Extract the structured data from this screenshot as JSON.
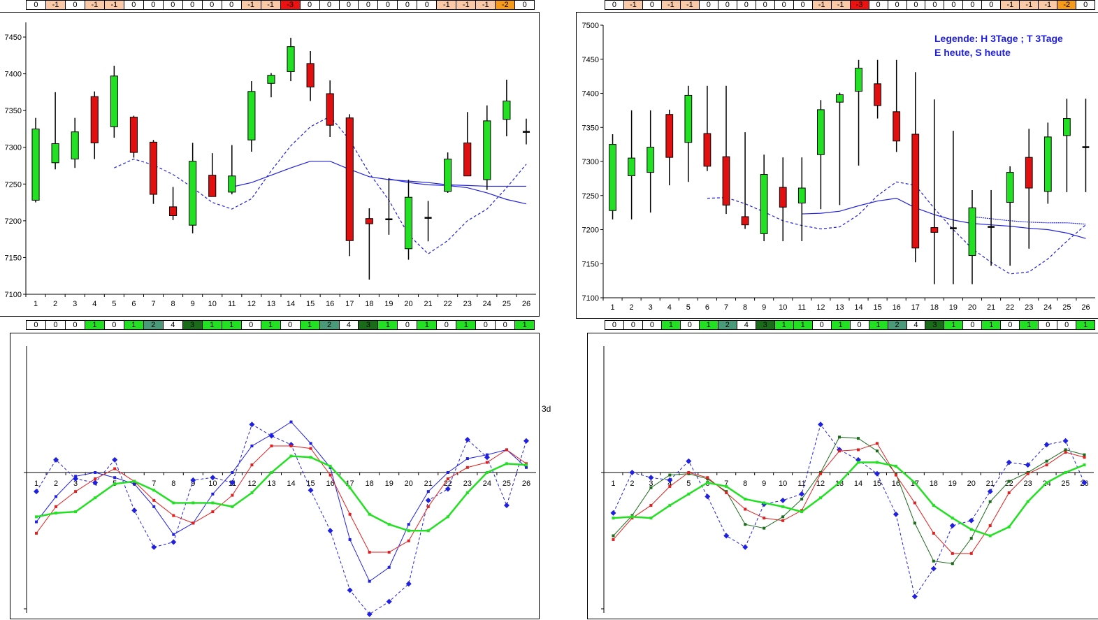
{
  "strips": {
    "top_left": [
      "0",
      "-1",
      "0",
      "-1",
      "-1",
      "0",
      "0",
      "0",
      "0",
      "0",
      "0",
      "-1",
      "-1",
      "-3",
      "0",
      "0",
      "0",
      "0",
      "0",
      "0",
      "0",
      "-1",
      "-1",
      "-1",
      "-2",
      "0"
    ],
    "top_right": [
      "0",
      "-1",
      "0",
      "-1",
      "-1",
      "0",
      "0",
      "0",
      "0",
      "0",
      "0",
      "-1",
      "-1",
      "-3",
      "0",
      "0",
      "0",
      "0",
      "0",
      "0",
      "0",
      "-1",
      "-1",
      "-1",
      "-2",
      "0"
    ],
    "bottom_left": [
      "0",
      "0",
      "0",
      "1",
      "0",
      "1",
      "2",
      "4",
      "3",
      "1",
      "1",
      "0",
      "1",
      "0",
      "1",
      "2",
      "4",
      "3",
      "1",
      "0",
      "1",
      "0",
      "1",
      "0",
      "0",
      "1"
    ],
    "bottom_right": [
      "0",
      "0",
      "0",
      "1",
      "0",
      "1",
      "2",
      "4",
      "3",
      "1",
      "1",
      "0",
      "1",
      "0",
      "1",
      "2",
      "4",
      "3",
      "1",
      "0",
      "1",
      "0",
      "1",
      "0",
      "0",
      "1"
    ]
  },
  "colors": {
    "up_candle": "#22e022",
    "down_candle": "#e01010",
    "ma_blue": "#2020e0",
    "line_red": "#e02020",
    "line_green": "#22e022",
    "line_darkgreen": "#1a6b1a",
    "neg1": "#f9c9a8",
    "neg2": "#f59a1a",
    "neg3": "#ee1111",
    "pos1": "#22e022",
    "pos2": "#4a9a7a",
    "pos3": "#1a6b1a",
    "pos4": "#ffffff"
  },
  "legend": {
    "line1": "Legende: H 3Tage ; T 3Tage",
    "line2": "E heute, S heute"
  },
  "side_label": "3d",
  "chart_data": [
    {
      "type": "candlestick",
      "categories": [
        "1",
        "2",
        "3",
        "4",
        "5",
        "6",
        "7",
        "8",
        "9",
        "10",
        "11",
        "12",
        "13",
        "14",
        "15",
        "16",
        "17",
        "18",
        "19",
        "20",
        "21",
        "22",
        "23",
        "24",
        "25",
        "26"
      ],
      "yticks": [
        7100,
        7150,
        7200,
        7250,
        7300,
        7350,
        7400,
        7450
      ],
      "ylim": [
        7100,
        7470
      ],
      "candles": [
        {
          "o": 7228,
          "c": 7325,
          "h": 7340,
          "l": 7225
        },
        {
          "o": 7279,
          "c": 7305,
          "h": 7375,
          "l": 7270
        },
        {
          "o": 7284,
          "c": 7321,
          "h": 7340,
          "l": 7272
        },
        {
          "o": 7369,
          "c": 7306,
          "h": 7376,
          "l": 7284
        },
        {
          "o": 7328,
          "c": 7397,
          "h": 7411,
          "l": 7313
        },
        {
          "o": 7341,
          "c": 7293,
          "h": 7343,
          "l": 7286
        },
        {
          "o": 7307,
          "c": 7236,
          "h": 7310,
          "l": 7223
        },
        {
          "o": 7219,
          "c": 7207,
          "h": 7246,
          "l": 7201
        },
        {
          "o": 7194,
          "c": 7281,
          "h": 7306,
          "l": 7183
        },
        {
          "o": 7262,
          "c": 7233,
          "h": 7292,
          "l": 7233
        },
        {
          "o": 7239,
          "c": 7261,
          "h": 7303,
          "l": 7236
        },
        {
          "o": 7310,
          "c": 7376,
          "h": 7390,
          "l": 7294
        },
        {
          "o": 7387,
          "c": 7398,
          "h": 7401,
          "l": 7368
        },
        {
          "o": 7403,
          "c": 7437,
          "h": 7449,
          "l": 7390
        },
        {
          "o": 7414,
          "c": 7382,
          "h": 7431,
          "l": 7363
        },
        {
          "o": 7373,
          "c": 7330,
          "h": 7391,
          "l": 7314
        },
        {
          "o": 7340,
          "c": 7173,
          "h": 7345,
          "l": 7152
        },
        {
          "o": 7203,
          "c": 7196,
          "h": 7217,
          "l": 7120
        },
        {
          "o": 7202,
          "c": 7202,
          "h": 7258,
          "l": 7181
        },
        {
          "o": 7162,
          "c": 7232,
          "h": 7256,
          "l": 7147
        },
        {
          "o": 7204,
          "c": 7204,
          "h": 7227,
          "l": 7172
        },
        {
          "o": 7240,
          "c": 7284,
          "h": 7293,
          "l": 7238
        },
        {
          "o": 7306,
          "c": 7261,
          "h": 7348,
          "l": 7262
        },
        {
          "o": 7256,
          "c": 7336,
          "h": 7357,
          "l": 7242
        },
        {
          "o": 7338,
          "c": 7363,
          "h": 7392,
          "l": 7315
        },
        {
          "o": 7321,
          "c": 7321,
          "h": 7339,
          "l": 7304
        }
      ],
      "series": [
        {
          "style": "solid",
          "values": [
            null,
            null,
            null,
            null,
            null,
            null,
            null,
            null,
            null,
            null,
            7246,
            7252,
            7262,
            7272,
            7281,
            7281,
            7270,
            7260,
            7256,
            7254,
            7252,
            7249,
            7248,
            7247,
            7247,
            7247
          ]
        },
        {
          "style": "dashed",
          "values": [
            null,
            null,
            null,
            null,
            7272,
            7284,
            7276,
            7263,
            7245,
            7225,
            7216,
            7230,
            7268,
            7302,
            7328,
            7342,
            7310,
            7265,
            7228,
            7181,
            7155,
            7173,
            7200,
            7216,
            7245,
            7277
          ]
        },
        {
          "style": "solid",
          "values": [
            null,
            null,
            null,
            null,
            null,
            null,
            null,
            null,
            null,
            null,
            null,
            null,
            null,
            null,
            null,
            null,
            null,
            null,
            7257,
            7252,
            7249,
            7248,
            7245,
            7238,
            7229,
            7223
          ]
        }
      ]
    },
    {
      "type": "candlestick",
      "categories": [
        "1",
        "2",
        "3",
        "4",
        "5",
        "6",
        "7",
        "8",
        "9",
        "10",
        "11",
        "12",
        "13",
        "14",
        "15",
        "16",
        "17",
        "18",
        "19",
        "20",
        "21",
        "22",
        "23",
        "24",
        "25",
        "26"
      ],
      "yticks": [
        7100,
        7150,
        7200,
        7250,
        7300,
        7350,
        7400,
        7450,
        7500
      ],
      "ylim": [
        7100,
        7500
      ],
      "candles": [
        {
          "o": 7228,
          "c": 7325,
          "h": 7340,
          "l": 7215
        },
        {
          "o": 7279,
          "c": 7305,
          "h": 7375,
          "l": 7215
        },
        {
          "o": 7284,
          "c": 7321,
          "h": 7375,
          "l": 7225
        },
        {
          "o": 7369,
          "c": 7306,
          "h": 7376,
          "l": 7265
        },
        {
          "o": 7328,
          "c": 7397,
          "h": 7411,
          "l": 7270
        },
        {
          "o": 7341,
          "c": 7293,
          "h": 7411,
          "l": 7286
        },
        {
          "o": 7307,
          "c": 7236,
          "h": 7411,
          "l": 7223
        },
        {
          "o": 7219,
          "c": 7207,
          "h": 7343,
          "l": 7201
        },
        {
          "o": 7194,
          "c": 7281,
          "h": 7310,
          "l": 7183
        },
        {
          "o": 7262,
          "c": 7233,
          "h": 7306,
          "l": 7183
        },
        {
          "o": 7239,
          "c": 7261,
          "h": 7306,
          "l": 7183
        },
        {
          "o": 7310,
          "c": 7376,
          "h": 7390,
          "l": 7230
        },
        {
          "o": 7387,
          "c": 7398,
          "h": 7401,
          "l": 7236
        },
        {
          "o": 7403,
          "c": 7437,
          "h": 7449,
          "l": 7294
        },
        {
          "o": 7414,
          "c": 7382,
          "h": 7449,
          "l": 7363
        },
        {
          "o": 7373,
          "c": 7330,
          "h": 7449,
          "l": 7314
        },
        {
          "o": 7340,
          "c": 7173,
          "h": 7431,
          "l": 7152
        },
        {
          "o": 7203,
          "c": 7196,
          "h": 7391,
          "l": 7120
        },
        {
          "o": 7202,
          "c": 7202,
          "h": 7345,
          "l": 7120
        },
        {
          "o": 7162,
          "c": 7232,
          "h": 7258,
          "l": 7120
        },
        {
          "o": 7204,
          "c": 7204,
          "h": 7258,
          "l": 7147
        },
        {
          "o": 7240,
          "c": 7284,
          "h": 7293,
          "l": 7147
        },
        {
          "o": 7306,
          "c": 7261,
          "h": 7348,
          "l": 7172
        },
        {
          "o": 7256,
          "c": 7336,
          "h": 7357,
          "l": 7238
        },
        {
          "o": 7338,
          "c": 7363,
          "h": 7392,
          "l": 7255
        },
        {
          "o": 7321,
          "c": 7321,
          "h": 7392,
          "l": 7255
        }
      ],
      "series": [
        {
          "style": "solid",
          "values": [
            null,
            null,
            null,
            null,
            null,
            null,
            null,
            null,
            null,
            null,
            7223,
            7224,
            7227,
            7235,
            7242,
            7246,
            7232,
            7222,
            7214,
            7209,
            7207,
            7205,
            7202,
            7200,
            7195,
            7187
          ]
        },
        {
          "style": "dashed",
          "values": [
            null,
            null,
            null,
            null,
            null,
            7246,
            7247,
            7238,
            7226,
            7213,
            7206,
            7201,
            7204,
            7222,
            7250,
            7270,
            7265,
            7231,
            7200,
            7172,
            7152,
            7135,
            7138,
            7157,
            7183,
            7207
          ]
        },
        {
          "style": "dashed-dense",
          "values": [
            null,
            null,
            null,
            null,
            null,
            null,
            null,
            null,
            null,
            null,
            null,
            null,
            null,
            null,
            null,
            null,
            null,
            null,
            null,
            7219,
            7216,
            7213,
            7211,
            7210,
            7210,
            7208
          ]
        }
      ]
    },
    {
      "type": "line",
      "categories": [
        "1",
        "2",
        "3",
        "4",
        "5",
        "6",
        "7",
        "8",
        "9",
        "10",
        "11",
        "12",
        "13",
        "14",
        "15",
        "16",
        "17",
        "18",
        "19",
        "20",
        "21",
        "22",
        "23",
        "24",
        "25",
        "26"
      ],
      "ylim": [
        -100,
        100
      ],
      "series": [
        {
          "color": "blue",
          "style": "dashed",
          "marker": "diamond",
          "values": [
            -15,
            10,
            -5,
            -8,
            10,
            -30,
            -59,
            -55,
            -6,
            -4,
            -8,
            38,
            29,
            22,
            -14,
            -46,
            -93,
            -112,
            -102,
            -88,
            -22,
            -13,
            26,
            12,
            -26,
            25
          ]
        },
        {
          "color": "blue",
          "style": "solid",
          "marker": "square",
          "values": [
            -39,
            -19,
            -3,
            0,
            -4,
            -9,
            -27,
            -49,
            -40,
            -17,
            0,
            21,
            30,
            40,
            23,
            4,
            -53,
            -86,
            -75,
            -41,
            -15,
            0,
            11,
            14,
            18,
            4
          ]
        },
        {
          "color": "red",
          "style": "solid",
          "marker": "square",
          "values": [
            -48,
            -27,
            -15,
            -5,
            3,
            -7,
            -22,
            -34,
            -40,
            -31,
            -18,
            6,
            21,
            21,
            19,
            -2,
            -33,
            -63,
            -63,
            -54,
            -27,
            -5,
            4,
            8,
            18,
            7
          ]
        },
        {
          "color": "green",
          "style": "solid",
          "marker": "square",
          "values": [
            -35,
            -32,
            -31,
            -20,
            -9,
            -7,
            -14,
            -24,
            -24,
            -24,
            -27,
            -16,
            0,
            13,
            12,
            5,
            -12,
            -33,
            -41,
            -46,
            -46,
            -35,
            -16,
            0,
            7,
            6
          ]
        }
      ]
    },
    {
      "type": "line",
      "categories": [
        "1",
        "2",
        "3",
        "4",
        "5",
        "6",
        "7",
        "8",
        "9",
        "10",
        "11",
        "12",
        "13",
        "14",
        "15",
        "16",
        "17",
        "18",
        "19",
        "20",
        "21",
        "22",
        "23",
        "24",
        "25",
        "26"
      ],
      "ylim": [
        -100,
        100
      ],
      "series": [
        {
          "color": "blue",
          "style": "dashed",
          "marker": "diamond",
          "values": [
            -32,
            0,
            -4,
            -6,
            9,
            -19,
            -50,
            -59,
            -25,
            -22,
            -17,
            38,
            18,
            10,
            -1,
            -33,
            -98,
            -76,
            -42,
            -38,
            -15,
            8,
            6,
            22,
            25,
            -8
          ]
        },
        {
          "color": "darkgreen",
          "style": "solid",
          "marker": "square",
          "values": [
            -50,
            -34,
            -12,
            -2,
            -1,
            -5,
            -15,
            -41,
            -44,
            -35,
            -21,
            0,
            28,
            27,
            17,
            -1,
            -40,
            -70,
            -72,
            -52,
            -23,
            -7,
            0,
            9,
            18,
            14
          ]
        },
        {
          "color": "red",
          "style": "solid",
          "marker": "square",
          "values": [
            -53,
            -36,
            -26,
            -11,
            0,
            -4,
            -16,
            -29,
            -36,
            -38,
            -30,
            -1,
            17,
            18,
            23,
            -2,
            -24,
            -48,
            -64,
            -64,
            -42,
            -16,
            -1,
            6,
            16,
            12
          ]
        },
        {
          "color": "green",
          "style": "solid",
          "marker": "square",
          "values": [
            -36,
            -35,
            -36,
            -26,
            -17,
            -8,
            -11,
            -21,
            -24,
            -27,
            -31,
            -20,
            -8,
            8,
            8,
            5,
            -8,
            -26,
            -36,
            -45,
            -50,
            -43,
            -23,
            -8,
            0,
            6
          ]
        }
      ]
    }
  ]
}
